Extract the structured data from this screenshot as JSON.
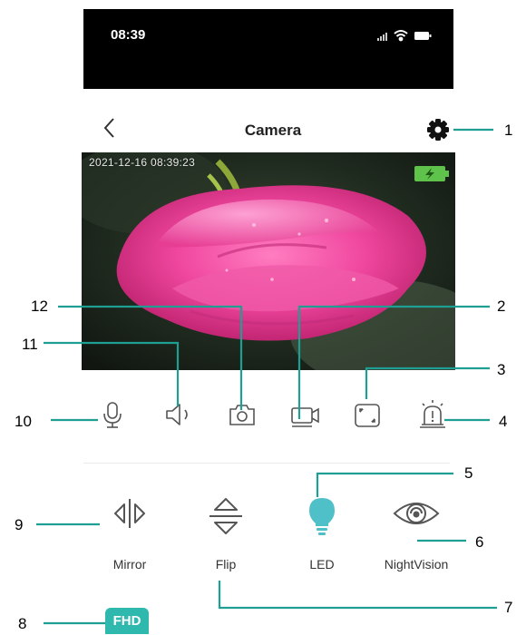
{
  "status_bar": {
    "time": "08:39",
    "icons": [
      "signal-icon",
      "wifi-icon",
      "battery-icon"
    ]
  },
  "header": {
    "title": "Camera",
    "back_icon": "chevron-left-icon",
    "settings_icon": "gear-icon"
  },
  "video": {
    "timestamp": "2021-12-16 08:39:23",
    "battery_icon": "charging-battery-icon"
  },
  "controls": [
    {
      "name": "microphone",
      "icon": "microphone-icon"
    },
    {
      "name": "speaker",
      "icon": "speaker-icon"
    },
    {
      "name": "snapshot",
      "icon": "camera-icon"
    },
    {
      "name": "record",
      "icon": "video-record-icon"
    },
    {
      "name": "fullscreen",
      "icon": "fullscreen-icon"
    },
    {
      "name": "alarm",
      "icon": "alarm-icon"
    }
  ],
  "features": [
    {
      "label": "Mirror",
      "icon": "mirror-icon"
    },
    {
      "label": "Flip",
      "icon": "flip-icon"
    },
    {
      "label": "LED",
      "icon": "bulb-icon"
    },
    {
      "label": "NightVision",
      "icon": "eye-icon"
    }
  ],
  "quality_button": {
    "label": "FHD"
  },
  "callouts": [
    "1",
    "2",
    "3",
    "4",
    "5",
    "6",
    "7",
    "8",
    "9",
    "10",
    "11",
    "12"
  ],
  "colors": {
    "accent": "#2fb8ad",
    "led": "#4fc0c8",
    "icon": "#555555"
  }
}
